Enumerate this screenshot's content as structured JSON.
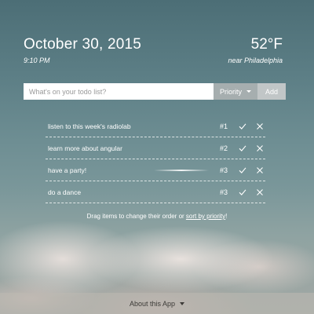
{
  "header": {
    "date": "October 30, 2015",
    "time": "9:10 PM",
    "temperature": "52°F",
    "location": "near Philadelphia"
  },
  "add_bar": {
    "placeholder": "What's on your todo list?",
    "priority_label": "Priority",
    "add_label": "Add"
  },
  "todos": [
    {
      "text": "listen to this week's radiolab",
      "priority": "#1"
    },
    {
      "text": "learn more about angular",
      "priority": "#2"
    },
    {
      "text": "have a party!",
      "priority": "#3"
    },
    {
      "text": "do a dance",
      "priority": "#3"
    }
  ],
  "hint": {
    "prefix": "Drag items to change their order or ",
    "link": "sort by priority",
    "suffix": "!"
  },
  "footer": {
    "label": "About this App"
  },
  "icons": {
    "done": "check-icon",
    "delete": "close-icon",
    "dropdown": "caret-down-icon"
  }
}
